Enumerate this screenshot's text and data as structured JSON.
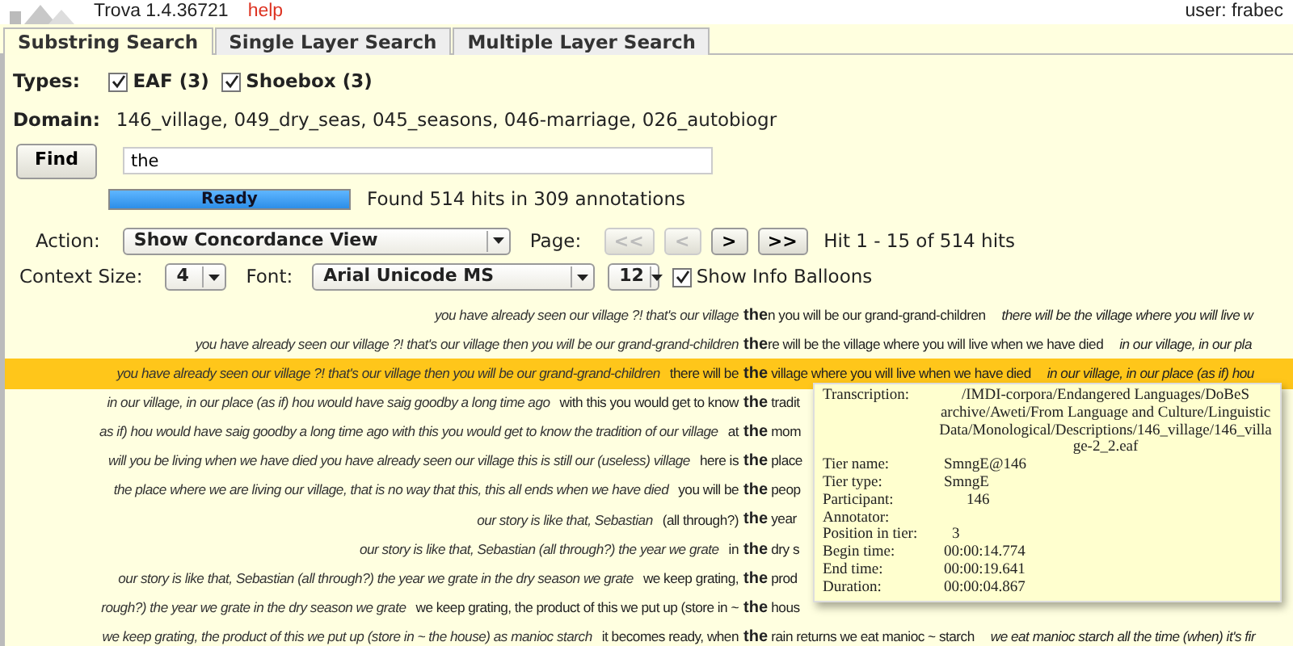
{
  "app": {
    "title": "Trova 1.4.36721",
    "help": "help",
    "user_label": "user:",
    "user": "frabec"
  },
  "tabs": [
    {
      "label": "Substring Search",
      "selected": true
    },
    {
      "label": "Single Layer Search",
      "selected": false
    },
    {
      "label": "Multiple Layer Search",
      "selected": false
    }
  ],
  "types": {
    "label": "Types:",
    "options": [
      {
        "label": "EAF (3)",
        "checked": true
      },
      {
        "label": "Shoebox (3)",
        "checked": true
      }
    ]
  },
  "domain": {
    "label": "Domain:",
    "value": "146_village, 049_dry_seas, 045_seasons, 046-marriage, 026_autobiogr"
  },
  "find": {
    "button": "Find",
    "value": "the"
  },
  "progress": {
    "label": "Ready",
    "level": 1,
    "status": "Found 514 hits in 309 annotations"
  },
  "action": {
    "label": "Action:",
    "value": "Show Concordance View"
  },
  "page": {
    "label": "Page:",
    "buttons": [
      {
        "label": "<<",
        "disabled": true
      },
      {
        "label": "<",
        "disabled": true
      },
      {
        "label": ">",
        "disabled": false
      },
      {
        "label": ">>",
        "disabled": false
      }
    ],
    "hits": "Hit 1 - 15 of 514 hits"
  },
  "context": {
    "label": "Context Size:",
    "value": "4",
    "font_label": "Font:",
    "font": "Arial Unicode MS",
    "size": "12",
    "balloons": {
      "label": "Show Info Balloons",
      "checked": true
    }
  },
  "rows": [
    {
      "left": "you have already seen our village ?!  that's our village",
      "keyword": "the",
      "after": "n you will be our grand-grand-children",
      "right": "there will be the village where you will live w",
      "selected": false
    },
    {
      "left": "you have already seen our village ?!  that's our village  then you will be our grand-grand-children",
      "keyword": "the",
      "after": "re will be the village where you will live when we have died",
      "right": "in our village, in our pla",
      "selected": false
    },
    {
      "left": "you have already seen our village ?!  that's our village  then you will be our grand-grand-children",
      "before": "there will be",
      "keyword": "the",
      "after": " village where you will live when we have died",
      "right": "in our village, in our place (as if) hou",
      "selected": true
    },
    {
      "left": "in our village, in our place  (as if) hou would have saig goodby a long time ago",
      "before": "with this you would get to know",
      "keyword": "the",
      "after": " tradit",
      "selected": false
    },
    {
      "left": "as if) hou would have saig goodby a long time ago  with this you would get to know the tradition of our village",
      "before": "at",
      "keyword": "the",
      "after": " mom",
      "selected": false
    },
    {
      "left": "will you be living when we have died  you have already seen our village  this is still our (useless) village",
      "before": "here is",
      "keyword": "the",
      "after": " place",
      "selected": false
    },
    {
      "left": "the place where we are living  our village, that is  no way that this, this all ends  when we have died",
      "before": "you will be",
      "keyword": "the",
      "after": " peop",
      "selected": false
    },
    {
      "left": "our story is like that, Sebastian",
      "before": "(all through?)",
      "keyword": "the",
      "after": " year",
      "selected": false
    },
    {
      "left": "our story is like that, Sebastian  (all through?) the year we grate",
      "before": "in",
      "keyword": "the",
      "after": " dry s",
      "selected": false
    },
    {
      "left": "our story is like that, Sebastian  (all through?) the year we grate  in the dry season  we grate",
      "before": "we keep grating,",
      "keyword": "the",
      "after": " prod",
      "selected": false
    },
    {
      "left": "rough?) the year we grate  in the dry season  we grate",
      "before": "we keep grating, the product of this we put up (store in ~",
      "keyword": "the",
      "after": " hous",
      "selected": false
    },
    {
      "left": "we keep grating, the product of this we put up (store in ~ the house) as manioc starch",
      "before": "it becomes ready, when",
      "keyword": "the",
      "after": " rain returns we eat manioc ~ starch",
      "right": "we eat manioc starch all the time (when) it's fir",
      "selected": false
    }
  ],
  "balloon": [
    {
      "label": "Transcription:",
      "value": "/IMDI-corpora/Endangered Languages/DoBeS archive/Aweti/From Language and Culture/Linguistic Data/Monological/Descriptions/146_village/146_village-2_2.eaf"
    },
    {
      "label": "Tier name:",
      "value": "SmngE@146"
    },
    {
      "label": "Tier type:",
      "value": "SmngE"
    },
    {
      "label": "Participant:",
      "value": "146"
    },
    {
      "label": "Annotator:"
    },
    {
      "label": "Position in tier:",
      "value": "3"
    },
    {
      "label": "Begin time:",
      "value": "00:00:14.774"
    },
    {
      "label": "End time:",
      "value": "00:00:19.641"
    },
    {
      "label": "Duration:",
      "value": "00:00:04.867"
    }
  ]
}
